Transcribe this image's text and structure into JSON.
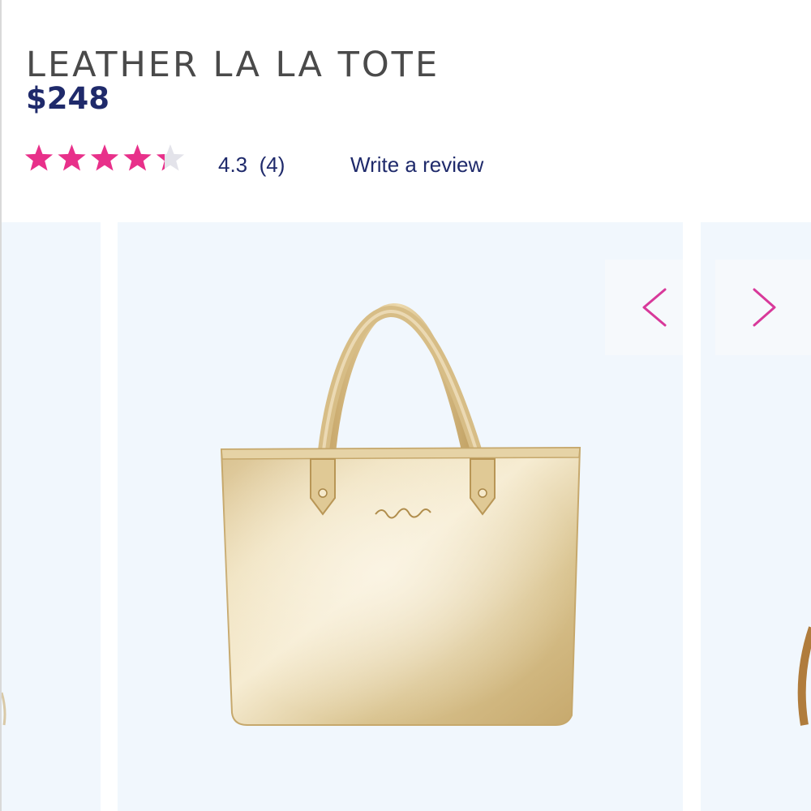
{
  "product": {
    "title": "LEATHER LA LA TOTE",
    "price": "$248"
  },
  "rating": {
    "value": 4.3,
    "max": 5,
    "summary": "4.3  (4)",
    "write_review_label": "Write a review",
    "star_color": "#e8308a",
    "empty_star_color": "#e3e3ea"
  },
  "gallery": {
    "main_image_icon": "gold-leather-tote-bag",
    "prev_icon": "chevron-left-icon",
    "next_icon": "chevron-right-icon",
    "arrow_color": "#d8399a",
    "image_background": "#f1f7fd"
  },
  "colors": {
    "title": "#4a4a4a",
    "brand_navy": "#1f2a6b"
  }
}
